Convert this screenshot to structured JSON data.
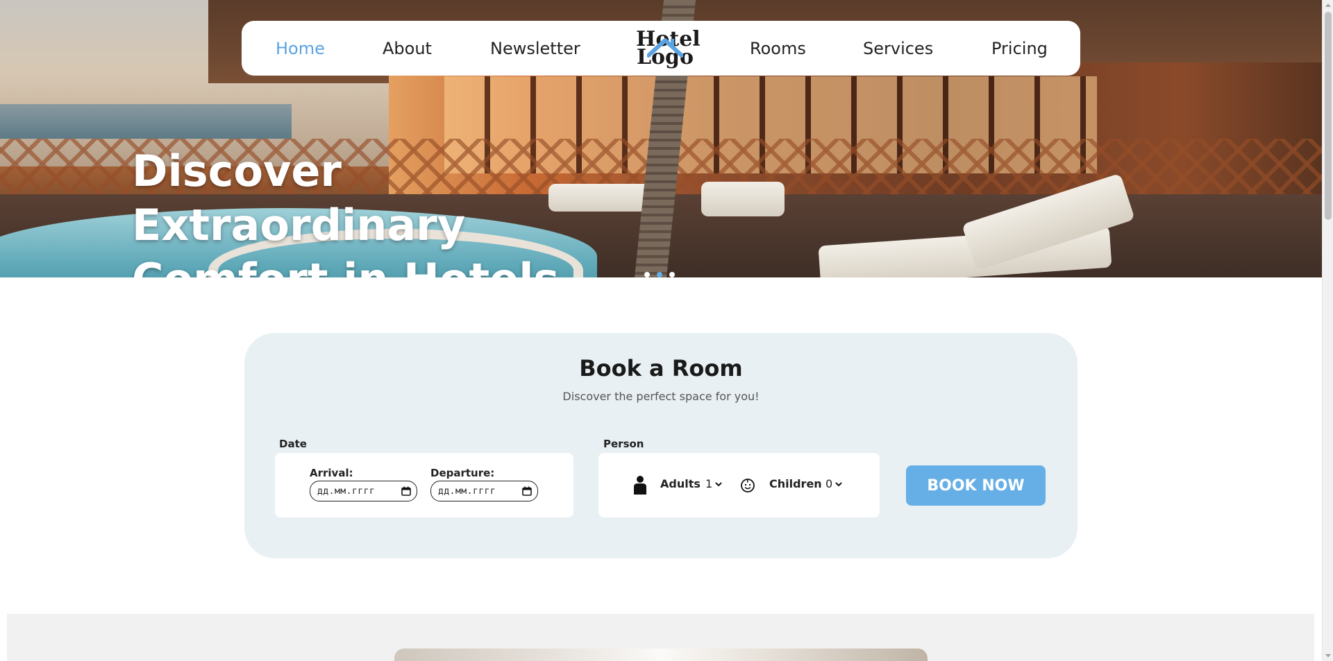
{
  "nav": {
    "items": [
      {
        "label": "Home",
        "active": true
      },
      {
        "label": "About",
        "active": false
      },
      {
        "label": "Newsletter",
        "active": false
      },
      {
        "label": "Rooms",
        "active": false
      },
      {
        "label": "Services",
        "active": false
      },
      {
        "label": "Pricing",
        "active": false
      }
    ],
    "logo": {
      "line1": "Hotel",
      "line2": "Logo"
    }
  },
  "hero": {
    "title_line1": "Discover Extraordinary",
    "title_line2": "Comfort in Hotels",
    "slides_count": 3,
    "active_slide": 2
  },
  "booking": {
    "title": "Book a Room",
    "subtitle": "Discover the perfect space for you!",
    "date_label": "Date",
    "arrival_label": "Arrival:",
    "arrival_placeholder": "дд.мм.гггг",
    "departure_label": "Departure:",
    "departure_placeholder": "дд.мм.гггг",
    "person_label": "Person",
    "adults_label": "Adults",
    "adults_value": "1",
    "children_label": "Children",
    "children_value": "0",
    "book_button": "BOOK NOW"
  },
  "colors": {
    "accent": "#66aee6",
    "booking_bg": "#e8f0f3",
    "text": "#222222"
  },
  "icons": {
    "person": "person-icon",
    "child": "baby-face-icon",
    "calendar": "calendar-icon",
    "chevron": "chevron-down-icon",
    "logo_roof": "house-roof-icon"
  }
}
